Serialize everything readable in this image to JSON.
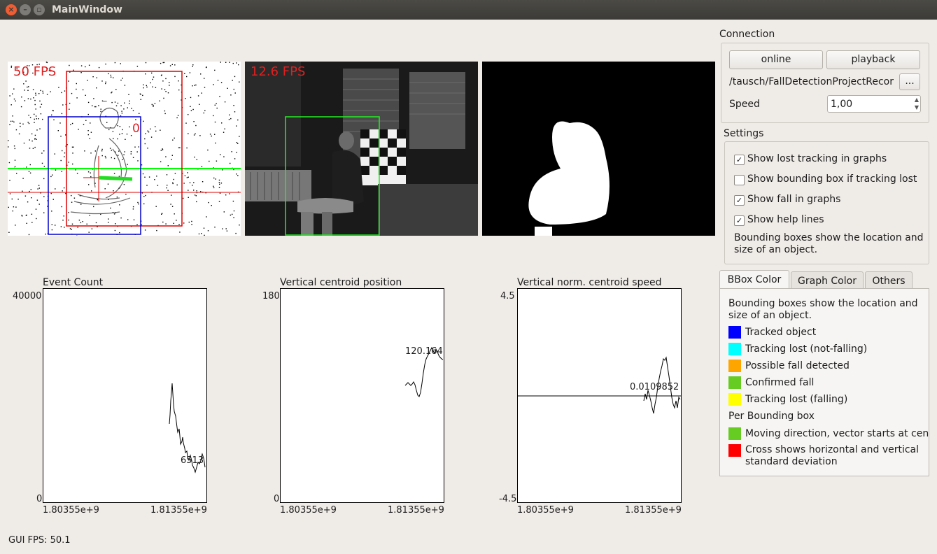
{
  "window": {
    "title": "MainWindow",
    "close_glyph": "×",
    "min_glyph": "–",
    "max_glyph": "▫"
  },
  "camera": {
    "panel1_fps": "50 FPS",
    "panel1_track_id": "0",
    "panel2_fps": "12.6 FPS"
  },
  "plots": [
    {
      "title": "Event Count",
      "ymax": "40000",
      "ymin": "0",
      "xmin": "1.80355e+9",
      "xmax": "1.81355e+9",
      "value_label": "6513"
    },
    {
      "title": "Vertical centroid position",
      "ymax": "180",
      "ymin": "0",
      "xmin": "1.80355e+9",
      "xmax": "1.81355e+9",
      "value_label": "120.164"
    },
    {
      "title": "Vertical norm. centroid speed",
      "ymax": "4.5",
      "ymin": "-4.5",
      "xmin": "1.80355e+9",
      "xmax": "1.81355e+9",
      "value_label": "0.0109852"
    }
  ],
  "status": {
    "gui_fps": "GUI FPS: 50.1"
  },
  "connection": {
    "label": "Connection",
    "online": "online",
    "playback": "playback",
    "path": "/tausch/FallDetectionProjectRecor",
    "browse": "...",
    "speed_label": "Speed",
    "speed_value": "1,00",
    "up_glyph": "▲",
    "down_glyph": "▼"
  },
  "settings": {
    "label": "Settings",
    "checkboxes": [
      {
        "label": "Show lost tracking in graphs",
        "checked": true,
        "mark": "✓"
      },
      {
        "label": "Show bounding box if tracking lost",
        "checked": false,
        "mark": ""
      },
      {
        "label": "Show fall in graphs",
        "checked": true,
        "mark": "✓"
      },
      {
        "label": "Show help lines",
        "checked": true,
        "mark": "✓"
      }
    ],
    "description_line1": "Bounding boxes show the location and",
    "description_line2": "size of an object."
  },
  "tabs": [
    {
      "label": "BBox Color",
      "active": true
    },
    {
      "label": "Graph Color",
      "active": false
    },
    {
      "label": "Others",
      "active": false
    }
  ],
  "bbox_color": {
    "desc_line1": "Bounding boxes show the location and",
    "desc_line2": "size of an object.",
    "items": [
      {
        "label": "Tracked object",
        "color": "#0000ff"
      },
      {
        "label": "Tracking lost (not-falling)",
        "color": "#00ffff"
      },
      {
        "label": "Possible fall detected",
        "color": "#ffa500"
      },
      {
        "label": "Confirmed fall",
        "color": "#66cc22"
      },
      {
        "label": "Tracking lost (falling)",
        "color": "#ffff00"
      }
    ],
    "per_box_label": "Per Bounding box",
    "per_box_items": [
      {
        "label": "Moving direction, vector starts at cen",
        "color": "#66cc22"
      },
      {
        "label_line1": "Cross shows horizontal and vertical",
        "label_line2": "standard deviation",
        "color": "#ff0000"
      }
    ]
  },
  "colors": {
    "fps_red": "#e02020",
    "track_green": "#00ff00",
    "track_blue": "#0000cc",
    "track_red": "#e00000"
  }
}
